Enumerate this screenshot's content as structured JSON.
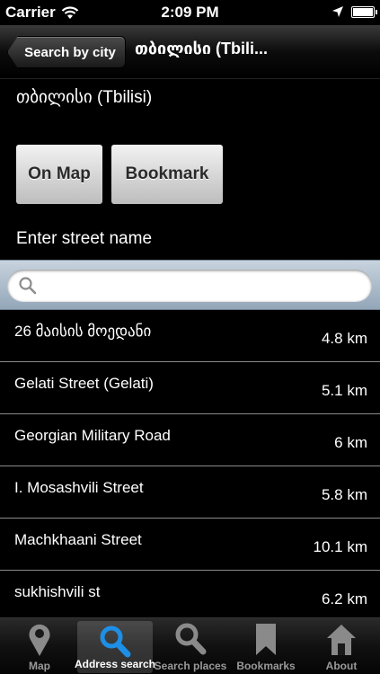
{
  "status_bar": {
    "carrier": "Carrier",
    "time": "2:09 PM"
  },
  "nav_bar": {
    "back_label": "Search by city",
    "title": "თბილისი (Tbili..."
  },
  "city_name": "თბილისი (Tbilisi)",
  "actions": {
    "map_label": "On Map",
    "bookmark_label": "Bookmark"
  },
  "street_prompt": "Enter street name",
  "search": {
    "placeholder": "",
    "value": ""
  },
  "streets": [
    {
      "name": "26 მაისის მოედანი",
      "distance": "4.8 km"
    },
    {
      "name": "Gelati Street (Gelati)",
      "distance": "5.1 km"
    },
    {
      "name": "Georgian Military Road",
      "distance": "6 km"
    },
    {
      "name": "I. Mosashvili Street",
      "distance": "5.8 km"
    },
    {
      "name": "Machkhaani Street",
      "distance": "10.1 km"
    },
    {
      "name": "sukhishvili st",
      "distance": "6.2 km"
    }
  ],
  "tabs": [
    {
      "label": "Map",
      "icon": "map-pin-icon"
    },
    {
      "label": "Address search",
      "icon": "magnifier-icon",
      "active": true
    },
    {
      "label": "Search places",
      "icon": "magnifier-icon"
    },
    {
      "label": "Bookmarks",
      "icon": "bookmark-icon"
    },
    {
      "label": "About",
      "icon": "house-icon"
    }
  ],
  "colors": {
    "active_tab_icon": "#1e8fe6",
    "inactive_tab_icon": "#8a8a8a",
    "search_bar": "#a9b9c9"
  }
}
